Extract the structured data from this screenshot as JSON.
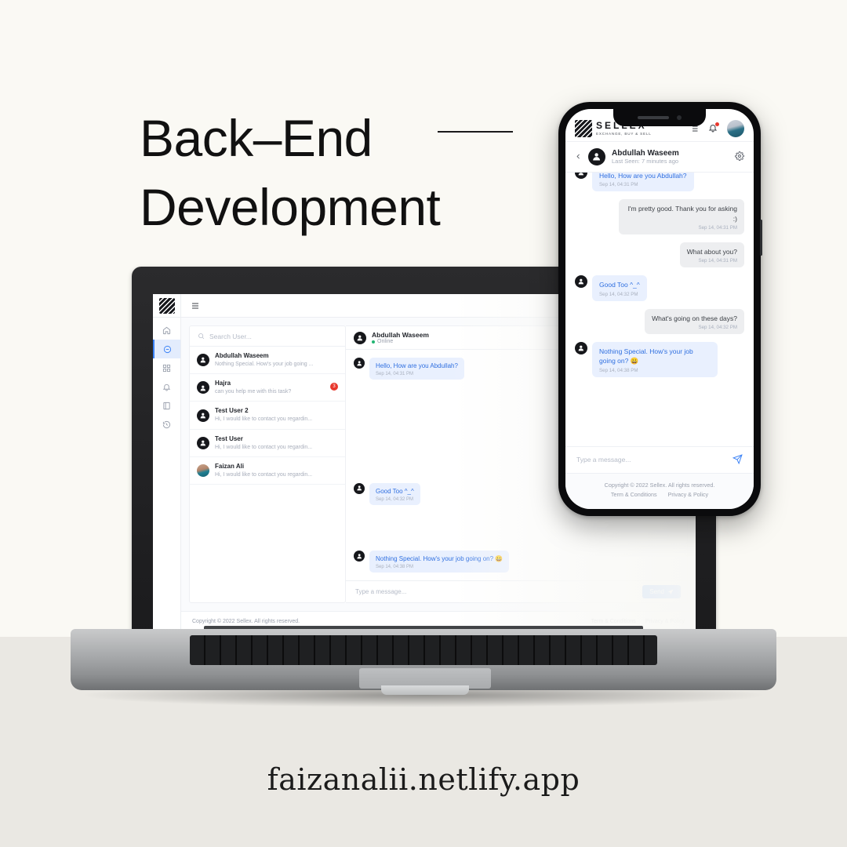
{
  "poster": {
    "headline_line1": "Back–End",
    "headline_line2": "Development",
    "site_url": "faizanalii.netlify.app",
    "bg_top_color": "#faf9f4",
    "bg_bottom_color": "#eae8e3",
    "accent_color": "#3b82f6"
  },
  "brand": {
    "name": "SELLEX",
    "tagline": "EXCHANGE, BUY & SELL"
  },
  "laptop_app": {
    "sidebar": {
      "items": [
        {
          "icon": "home-icon",
          "label": "Home",
          "active": false
        },
        {
          "icon": "chat-icon",
          "label": "Chat",
          "active": true
        },
        {
          "icon": "grid-icon",
          "label": "Dashboard",
          "active": false
        },
        {
          "icon": "bell-icon",
          "label": "Notifications",
          "active": false
        },
        {
          "icon": "book-icon",
          "label": "Listings",
          "active": false
        },
        {
          "icon": "history-icon",
          "label": "History",
          "active": false
        }
      ]
    },
    "topbar": {
      "menu_icon": "list-toggle-icon"
    },
    "search": {
      "placeholder": "Search User...",
      "icon": "search-icon"
    },
    "contacts": [
      {
        "name": "Abdullah Waseem",
        "preview": "Nothing Special. How's your job going ...",
        "badge": "",
        "avatar": "default"
      },
      {
        "name": "Hajra",
        "preview": "can you help me with this task?",
        "badge": "3",
        "avatar": "default"
      },
      {
        "name": "Test User 2",
        "preview": "Hi, I would like to contact you regardin...",
        "badge": "",
        "avatar": "default"
      },
      {
        "name": "Test User",
        "preview": "Hi, I would like to contact you regardin...",
        "badge": "",
        "avatar": "default"
      },
      {
        "name": "Faizan Ali",
        "preview": "Hi, I would like to contact you regardin...",
        "badge": "",
        "avatar": "photo"
      }
    ],
    "chat_header": {
      "name": "Abdullah Waseem",
      "status": "Online"
    },
    "messages": [
      {
        "side": "in",
        "text": "Hello, How are you Abdullah?",
        "time": "Sep 14, 04:31 PM"
      },
      {
        "side": "in",
        "text": "Good Too ^_^",
        "time": "Sep 14, 04:32 PM"
      },
      {
        "side": "in",
        "text": "Nothing Special. How's your job going on? 😀",
        "time": "Sep 14, 04:38 PM"
      }
    ],
    "composer": {
      "placeholder": "Type a message...",
      "send_label": "Send",
      "send_icon": "paper-plane-icon"
    },
    "footer": {
      "copyright": "Copyright © 2022 Sellex. All rights reserved.",
      "link_terms": "Term & Conditions",
      "link_privacy": "Privacy & Policy"
    }
  },
  "phone_app": {
    "header": {
      "list_icon": "list-toggle-icon",
      "bell_icon": "bell-icon",
      "avatar": "user-avatar",
      "has_notification": true
    },
    "chat_header": {
      "back_icon": "chevron-left-icon",
      "name": "Abdullah Waseem",
      "last_seen": "Last Seen: 7 minutes ago",
      "settings_icon": "gear-icon"
    },
    "messages": [
      {
        "side": "in",
        "text": "Hello, How are you Abdullah?",
        "time": "Sep 14, 04:31 PM"
      },
      {
        "side": "out",
        "text": "I'm pretty good. Thank you for asking :)",
        "time": "Sep 14, 04:31 PM"
      },
      {
        "side": "out",
        "text": "What about you?",
        "time": "Sep 14, 04:31 PM"
      },
      {
        "side": "in",
        "text": "Good Too ^_^",
        "time": "Sep 14, 04:32 PM"
      },
      {
        "side": "out",
        "text": "What's going on these days?",
        "time": "Sep 14, 04:32 PM"
      },
      {
        "side": "in",
        "text": "Nothing Special. How's your job going on? 😀",
        "time": "Sep 14, 04:38 PM"
      }
    ],
    "composer": {
      "placeholder": "Type a message...",
      "send_icon": "paper-plane-icon"
    },
    "footer": {
      "copyright": "Copyright © 2022 Sellex. All rights reserved.",
      "link_terms": "Term & Conditions",
      "link_privacy": "Privacy & Policy"
    }
  }
}
